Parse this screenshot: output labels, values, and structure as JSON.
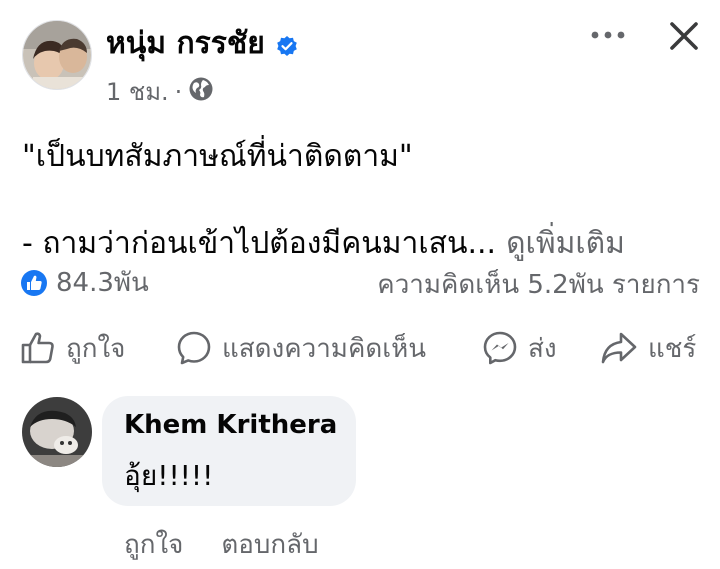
{
  "post": {
    "author": "หนุ่ม กรรชัย",
    "time": "1 ชม.",
    "separator": "·",
    "quote": "\"เป็นบทสัมภาษณ์ที่น่าติดตาม\"",
    "line2": "- ถามว่าก่อนเข้าไปต้องมีคนมาเสน...",
    "see_more": "ดูเพิ่มเติม",
    "reaction_count": "84.3พัน",
    "comments_count": "ความคิดเห็น 5.2พัน รายการ"
  },
  "actions": {
    "like": "ถูกใจ",
    "comment": "แสดงความคิดเห็น",
    "send": "ส่ง",
    "share": "แชร์"
  },
  "comment": {
    "name": "Khem Krithera",
    "text": "อุ้ย!!!!!",
    "like": "ถูกใจ",
    "reply": "ตอบกลับ"
  },
  "colors": {
    "accent": "#1877f2",
    "secondary_text": "#65676b",
    "bubble": "#f0f2f5"
  },
  "icons": [
    "more-icon",
    "close-icon",
    "globe-icon",
    "verified-icon",
    "like-reaction-icon",
    "thumbs-up-icon",
    "comment-icon",
    "messenger-icon",
    "share-icon"
  ]
}
